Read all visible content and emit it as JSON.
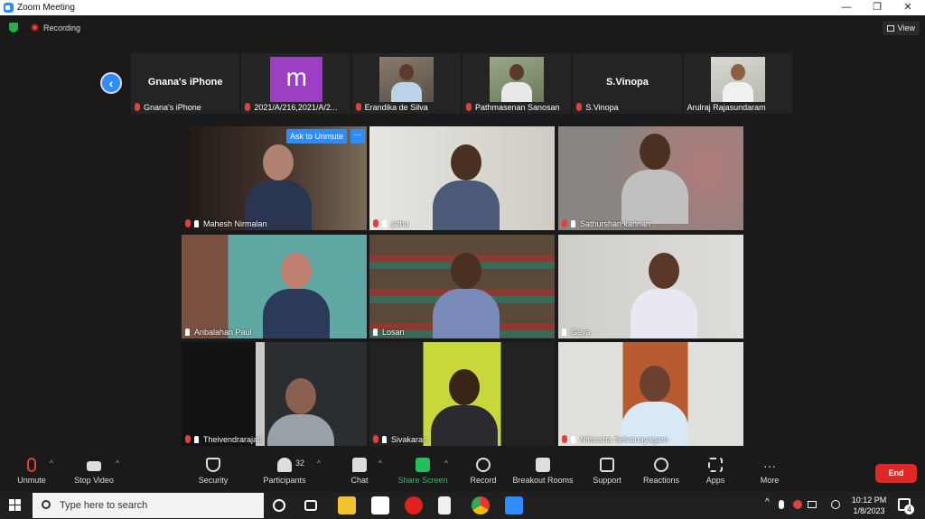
{
  "window": {
    "title": "Zoom Meeting",
    "minimize": "—",
    "restore": "❐",
    "close": "✕"
  },
  "status": {
    "recording_label": "Recording",
    "view_label": "View"
  },
  "strip": {
    "tiles": [
      {
        "big_name": "Gnana's iPhone",
        "label": "Gnana's iPhone"
      },
      {
        "avatar_letter": "m",
        "label": "2021/A/216,2021/A/2..."
      },
      {
        "label": "Erandika de Silva"
      },
      {
        "label": "Pathmasenan Sanosan"
      },
      {
        "big_name": "S.Vinopa",
        "label": "S.Vinopa"
      },
      {
        "label": "Arulraj Rajasundaram"
      }
    ]
  },
  "gallery": {
    "ask_unmute": "Ask to Unmute",
    "more": "···",
    "tiles": [
      {
        "name": "Mahesh Nirmalan",
        "bg": "#3a2e28"
      },
      {
        "name": "jathu",
        "bg": "#d9d6d0"
      },
      {
        "name": "Sathurshan kannan",
        "bg": "#a8a4a2"
      },
      {
        "name": "Anbalahan Paul",
        "bg": "#5fa8a4"
      },
      {
        "name": "Losan",
        "bg": "#6b5a48"
      },
      {
        "name": "Gaya",
        "bg": "#d8d6d2"
      },
      {
        "name": "Theivendrarajah",
        "bg": "#1e2224"
      },
      {
        "name": "Sivakaran",
        "bg": "#c8d83a"
      },
      {
        "name": "Nithusha Selvanayagam",
        "bg": "#e2e0dc"
      }
    ]
  },
  "toolbar": {
    "unmute": "Unmute",
    "stop_video": "Stop Video",
    "security": "Security",
    "participants": "Participants",
    "participants_count": "32",
    "chat": "Chat",
    "share_screen": "Share Screen",
    "record": "Record",
    "breakout_rooms": "Breakout Rooms",
    "support": "Support",
    "reactions": "Reactions",
    "apps": "Apps",
    "more": "More",
    "end": "End"
  },
  "taskbar": {
    "search_placeholder": "Type here to search",
    "time": "10:12 PM",
    "date": "1/8/2023",
    "notification_count": "4"
  },
  "colors": {
    "zoom_blue": "#2d8cff",
    "end_red": "#e02828",
    "share_green": "#22c05a"
  }
}
